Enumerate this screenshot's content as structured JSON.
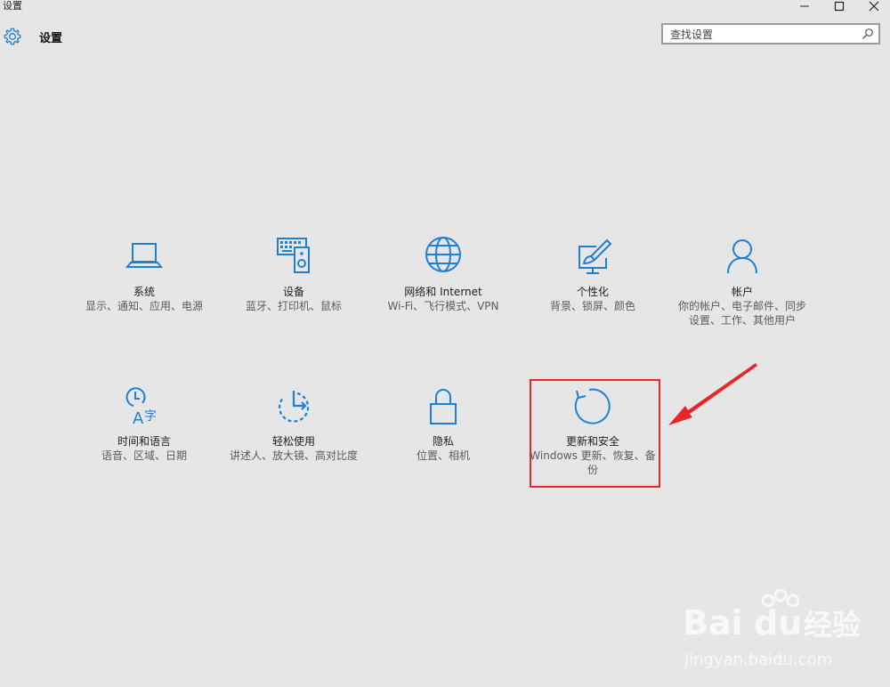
{
  "window": {
    "title": "设置"
  },
  "header": {
    "title": "设置",
    "search_placeholder": "查找设置"
  },
  "tiles": [
    {
      "title": "系统",
      "desc": "显示、通知、应用、电源"
    },
    {
      "title": "设备",
      "desc": "蓝牙、打印机、鼠标"
    },
    {
      "title": "网络和 Internet",
      "desc": "Wi-Fi、飞行模式、VPN"
    },
    {
      "title": "个性化",
      "desc": "背景、锁屏、颜色"
    },
    {
      "title": "帐户",
      "desc": "你的帐户、电子邮件、同步设置、工作、其他用户"
    },
    {
      "title": "时间和语言",
      "desc": "语音、区域、日期"
    },
    {
      "title": "轻松使用",
      "desc": "讲述人、放大镜、高对比度"
    },
    {
      "title": "隐私",
      "desc": "位置、相机"
    },
    {
      "title": "更新和安全",
      "desc": "Windows 更新、恢复、备份"
    }
  ],
  "watermark": {
    "brand": "Bai",
    "brand2": "du",
    "cn": "经验",
    "url": "jingyan.baidu.com"
  },
  "colors": {
    "accent": "#1e7fd6",
    "highlight": "#e8262a",
    "background": "#e6e6e6"
  }
}
